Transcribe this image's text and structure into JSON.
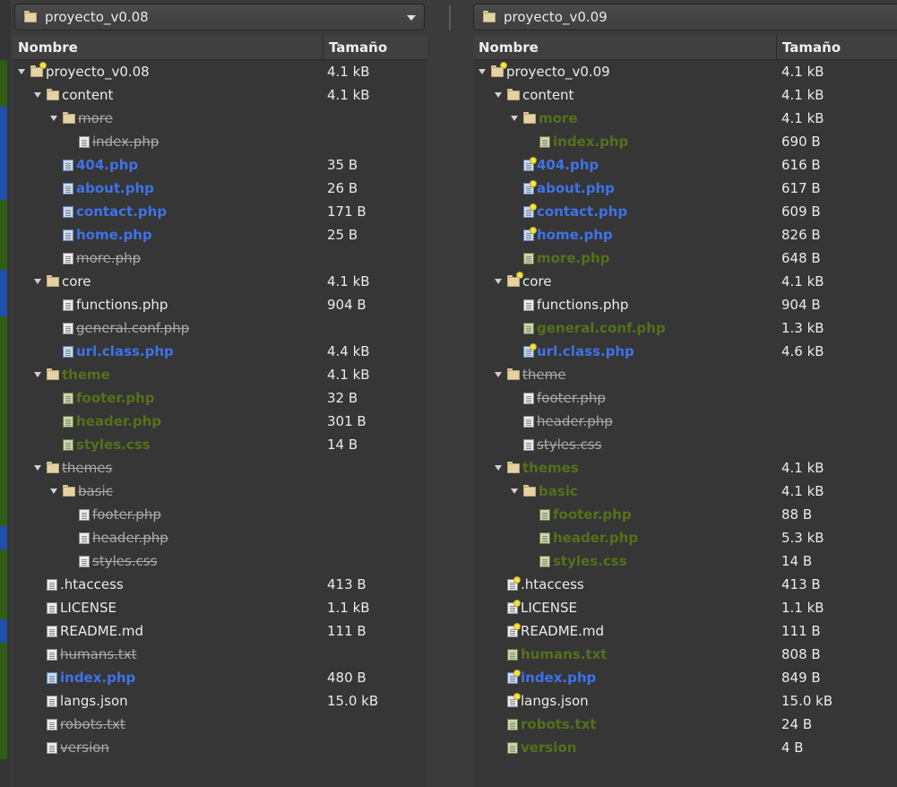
{
  "left": {
    "path_label": "proyecto_v0.08",
    "columns": {
      "name": "Nombre",
      "size": "Tamaño"
    },
    "rows": [
      {
        "name": "proyecto_v0.08",
        "size": "4.1 kB",
        "depth": 0,
        "type": "folder",
        "expanded": true,
        "style": "normal",
        "icon_color": "normal",
        "newmark": true
      },
      {
        "name": "content",
        "size": "4.1 kB",
        "depth": 1,
        "type": "folder",
        "expanded": true,
        "style": "normal",
        "icon_color": "normal",
        "newmark": false
      },
      {
        "name": "more",
        "size": "",
        "depth": 2,
        "type": "folder",
        "expanded": true,
        "style": "gray",
        "icon_color": "normal",
        "newmark": false
      },
      {
        "name": "index.php",
        "size": "",
        "depth": 3,
        "type": "file",
        "style": "gray",
        "icon_color": "normal",
        "newmark": false
      },
      {
        "name": "404.php",
        "size": "35 B",
        "depth": 2,
        "type": "file",
        "style": "blue",
        "icon_color": "blue",
        "newmark": false
      },
      {
        "name": "about.php",
        "size": "26 B",
        "depth": 2,
        "type": "file",
        "style": "blue",
        "icon_color": "blue",
        "newmark": false
      },
      {
        "name": "contact.php",
        "size": "171 B",
        "depth": 2,
        "type": "file",
        "style": "blue",
        "icon_color": "blue",
        "newmark": false
      },
      {
        "name": "home.php",
        "size": "25 B",
        "depth": 2,
        "type": "file",
        "style": "blue",
        "icon_color": "blue",
        "newmark": false
      },
      {
        "name": "more.php",
        "size": "",
        "depth": 2,
        "type": "file",
        "style": "gray",
        "icon_color": "normal",
        "newmark": false
      },
      {
        "name": "core",
        "size": "4.1 kB",
        "depth": 1,
        "type": "folder",
        "expanded": true,
        "style": "normal",
        "icon_color": "normal",
        "newmark": false
      },
      {
        "name": "functions.php",
        "size": "904 B",
        "depth": 2,
        "type": "file",
        "style": "normal",
        "icon_color": "normal",
        "newmark": false
      },
      {
        "name": "general.conf.php",
        "size": "",
        "depth": 2,
        "type": "file",
        "style": "gray",
        "icon_color": "normal",
        "newmark": false
      },
      {
        "name": "url.class.php",
        "size": "4.4 kB",
        "depth": 2,
        "type": "file",
        "style": "blue",
        "icon_color": "blue",
        "newmark": false
      },
      {
        "name": "theme",
        "size": "4.1 kB",
        "depth": 1,
        "type": "folder",
        "expanded": true,
        "style": "green",
        "icon_color": "normal",
        "newmark": false
      },
      {
        "name": "footer.php",
        "size": "32 B",
        "depth": 2,
        "type": "file",
        "style": "green",
        "icon_color": "green",
        "newmark": false
      },
      {
        "name": "header.php",
        "size": "301 B",
        "depth": 2,
        "type": "file",
        "style": "green",
        "icon_color": "green",
        "newmark": false
      },
      {
        "name": "styles.css",
        "size": "14 B",
        "depth": 2,
        "type": "file",
        "style": "green",
        "icon_color": "green",
        "newmark": false
      },
      {
        "name": "themes",
        "size": "",
        "depth": 1,
        "type": "folder",
        "expanded": true,
        "style": "gray",
        "icon_color": "normal",
        "newmark": false
      },
      {
        "name": "basic",
        "size": "",
        "depth": 2,
        "type": "folder",
        "expanded": true,
        "style": "gray",
        "icon_color": "normal",
        "newmark": false
      },
      {
        "name": "footer.php",
        "size": "",
        "depth": 3,
        "type": "file",
        "style": "gray",
        "icon_color": "normal",
        "newmark": false
      },
      {
        "name": "header.php",
        "size": "",
        "depth": 3,
        "type": "file",
        "style": "gray",
        "icon_color": "normal",
        "newmark": false
      },
      {
        "name": "styles.css",
        "size": "",
        "depth": 3,
        "type": "file",
        "style": "gray",
        "icon_color": "normal",
        "newmark": false
      },
      {
        "name": ".htaccess",
        "size": "413 B",
        "depth": 1,
        "type": "file",
        "style": "normal",
        "icon_color": "normal",
        "newmark": false
      },
      {
        "name": "LICENSE",
        "size": "1.1 kB",
        "depth": 1,
        "type": "file",
        "style": "normal",
        "icon_color": "normal",
        "newmark": false
      },
      {
        "name": "README.md",
        "size": "111 B",
        "depth": 1,
        "type": "file",
        "style": "normal",
        "icon_color": "normal",
        "newmark": false
      },
      {
        "name": "humans.txt",
        "size": "",
        "depth": 1,
        "type": "file",
        "style": "gray",
        "icon_color": "normal",
        "newmark": false
      },
      {
        "name": "index.php",
        "size": "480 B",
        "depth": 1,
        "type": "file",
        "style": "blue",
        "icon_color": "blue",
        "newmark": false
      },
      {
        "name": "langs.json",
        "size": "15.0 kB",
        "depth": 1,
        "type": "file",
        "style": "normal",
        "icon_color": "normal",
        "newmark": false
      },
      {
        "name": "robots.txt",
        "size": "",
        "depth": 1,
        "type": "file",
        "style": "gray",
        "icon_color": "normal",
        "newmark": false
      },
      {
        "name": "version",
        "size": "",
        "depth": 1,
        "type": "file",
        "style": "gray",
        "icon_color": "normal",
        "newmark": false
      }
    ]
  },
  "right": {
    "path_label": "proyecto_v0.09",
    "columns": {
      "name": "Nombre",
      "size": "Tamaño"
    },
    "rows": [
      {
        "name": "proyecto_v0.09",
        "size": "4.1 kB",
        "depth": 0,
        "type": "folder",
        "expanded": true,
        "style": "normal",
        "icon_color": "normal",
        "newmark": true
      },
      {
        "name": "content",
        "size": "4.1 kB",
        "depth": 1,
        "type": "folder",
        "expanded": true,
        "style": "normal",
        "icon_color": "normal",
        "newmark": false
      },
      {
        "name": "more",
        "size": "4.1 kB",
        "depth": 2,
        "type": "folder",
        "expanded": true,
        "style": "green",
        "icon_color": "normal",
        "newmark": false
      },
      {
        "name": "index.php",
        "size": "690 B",
        "depth": 3,
        "type": "file",
        "style": "green",
        "icon_color": "green",
        "newmark": false
      },
      {
        "name": "404.php",
        "size": "616 B",
        "depth": 2,
        "type": "file",
        "style": "blue",
        "icon_color": "blue",
        "newmark": true
      },
      {
        "name": "about.php",
        "size": "617 B",
        "depth": 2,
        "type": "file",
        "style": "blue",
        "icon_color": "blue",
        "newmark": true
      },
      {
        "name": "contact.php",
        "size": "609 B",
        "depth": 2,
        "type": "file",
        "style": "blue",
        "icon_color": "blue",
        "newmark": true
      },
      {
        "name": "home.php",
        "size": "826 B",
        "depth": 2,
        "type": "file",
        "style": "blue",
        "icon_color": "blue",
        "newmark": true
      },
      {
        "name": "more.php",
        "size": "648 B",
        "depth": 2,
        "type": "file",
        "style": "green",
        "icon_color": "green",
        "newmark": false
      },
      {
        "name": "core",
        "size": "4.1 kB",
        "depth": 1,
        "type": "folder",
        "expanded": true,
        "style": "normal",
        "icon_color": "normal",
        "newmark": true
      },
      {
        "name": "functions.php",
        "size": "904 B",
        "depth": 2,
        "type": "file",
        "style": "normal",
        "icon_color": "normal",
        "newmark": false
      },
      {
        "name": "general.conf.php",
        "size": "1.3 kB",
        "depth": 2,
        "type": "file",
        "style": "green",
        "icon_color": "green",
        "newmark": false
      },
      {
        "name": "url.class.php",
        "size": "4.6 kB",
        "depth": 2,
        "type": "file",
        "style": "blue",
        "icon_color": "blue",
        "newmark": true
      },
      {
        "name": "theme",
        "size": "",
        "depth": 1,
        "type": "folder",
        "expanded": true,
        "style": "gray",
        "icon_color": "normal",
        "newmark": false
      },
      {
        "name": "footer.php",
        "size": "",
        "depth": 2,
        "type": "file",
        "style": "gray",
        "icon_color": "normal",
        "newmark": false
      },
      {
        "name": "header.php",
        "size": "",
        "depth": 2,
        "type": "file",
        "style": "gray",
        "icon_color": "normal",
        "newmark": false
      },
      {
        "name": "styles.css",
        "size": "",
        "depth": 2,
        "type": "file",
        "style": "gray",
        "icon_color": "normal",
        "newmark": false
      },
      {
        "name": "themes",
        "size": "4.1 kB",
        "depth": 1,
        "type": "folder",
        "expanded": true,
        "style": "green",
        "icon_color": "normal",
        "newmark": false
      },
      {
        "name": "basic",
        "size": "4.1 kB",
        "depth": 2,
        "type": "folder",
        "expanded": true,
        "style": "green",
        "icon_color": "normal",
        "newmark": false
      },
      {
        "name": "footer.php",
        "size": "88 B",
        "depth": 3,
        "type": "file",
        "style": "green",
        "icon_color": "green",
        "newmark": false
      },
      {
        "name": "header.php",
        "size": "5.3 kB",
        "depth": 3,
        "type": "file",
        "style": "green",
        "icon_color": "green",
        "newmark": false
      },
      {
        "name": "styles.css",
        "size": "14 B",
        "depth": 3,
        "type": "file",
        "style": "green",
        "icon_color": "green",
        "newmark": false
      },
      {
        "name": ".htaccess",
        "size": "413 B",
        "depth": 1,
        "type": "file",
        "style": "normal",
        "icon_color": "normal",
        "newmark": true
      },
      {
        "name": "LICENSE",
        "size": "1.1 kB",
        "depth": 1,
        "type": "file",
        "style": "normal",
        "icon_color": "normal",
        "newmark": true
      },
      {
        "name": "README.md",
        "size": "111 B",
        "depth": 1,
        "type": "file",
        "style": "normal",
        "icon_color": "normal",
        "newmark": true
      },
      {
        "name": "humans.txt",
        "size": "808 B",
        "depth": 1,
        "type": "file",
        "style": "green",
        "icon_color": "green",
        "newmark": false
      },
      {
        "name": "index.php",
        "size": "849 B",
        "depth": 1,
        "type": "file",
        "style": "blue",
        "icon_color": "blue",
        "newmark": true
      },
      {
        "name": "langs.json",
        "size": "15.0 kB",
        "depth": 1,
        "type": "file",
        "style": "normal",
        "icon_color": "normal",
        "newmark": true
      },
      {
        "name": "robots.txt",
        "size": "24 B",
        "depth": 1,
        "type": "file",
        "style": "green",
        "icon_color": "green",
        "newmark": false
      },
      {
        "name": "version",
        "size": "4 B",
        "depth": 1,
        "type": "file",
        "style": "green",
        "icon_color": "green",
        "newmark": false
      }
    ]
  },
  "colors": {
    "modified": "#3e72e8",
    "added": "#55701a",
    "missing": "#a9a9a9",
    "gutter_blue": "#1f4fa8",
    "gutter_green": "#2f5d14"
  },
  "gutter_markers": [
    "green",
    "green",
    "blue",
    "blue",
    "blue",
    "blue",
    "green",
    "green",
    "green",
    "blue",
    "blue",
    "green",
    "green",
    "green",
    "green",
    "green",
    "green",
    "green",
    "green",
    "green",
    "blue",
    "green",
    "green",
    "green",
    "blue",
    "green",
    "green",
    "green",
    "green",
    "green"
  ]
}
